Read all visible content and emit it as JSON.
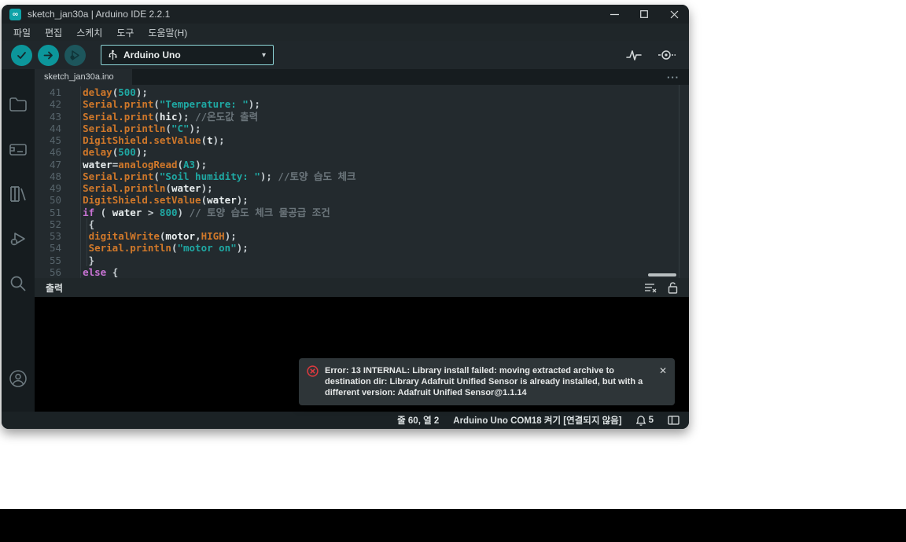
{
  "window": {
    "title": "sketch_jan30a | Arduino IDE 2.2.1"
  },
  "menu": {
    "items": [
      "파일",
      "편집",
      "스케치",
      "도구",
      "도움말(H)"
    ]
  },
  "toolbar": {
    "verify_icon": "check-icon",
    "upload_icon": "right-arrow-icon",
    "debug_icon": "debug-icon",
    "board_selector": {
      "label": "Arduino Uno",
      "usb_icon": "usb-icon",
      "caret": "▾"
    },
    "right_icons": [
      "serial-plotter-icon",
      "serial-monitor-icon"
    ]
  },
  "sidebar": {
    "items": [
      "sketchbook-folder",
      "boards-manager",
      "library-manager",
      "debug",
      "search"
    ],
    "bottom_item": "account"
  },
  "tabs": [
    {
      "label": "sketch_jan30a.ino",
      "active": true
    }
  ],
  "tab_bar": {
    "more": "···"
  },
  "editor": {
    "lines": [
      {
        "num": "41",
        "segs": [
          [
            "pl",
            "  "
          ],
          [
            "fn",
            "delay"
          ],
          [
            "pl",
            "("
          ],
          [
            "num",
            "500"
          ],
          [
            "pl",
            ");"
          ]
        ]
      },
      {
        "num": "42",
        "segs": [
          [
            "pl",
            "  "
          ],
          [
            "fn",
            "Serial.print"
          ],
          [
            "pl",
            "("
          ],
          [
            "str",
            "\"Temperature: \""
          ],
          [
            "pl",
            ");"
          ]
        ]
      },
      {
        "num": "43",
        "segs": [
          [
            "pl",
            "  "
          ],
          [
            "fn",
            "Serial.print"
          ],
          [
            "pl",
            "("
          ],
          [
            "id",
            "hic"
          ],
          [
            "pl",
            "); "
          ],
          [
            "cmt",
            "//온도값 출력"
          ]
        ]
      },
      {
        "num": "44",
        "segs": [
          [
            "pl",
            "  "
          ],
          [
            "fn",
            "Serial.println"
          ],
          [
            "pl",
            "("
          ],
          [
            "str",
            "\"C\""
          ],
          [
            "pl",
            ");"
          ]
        ]
      },
      {
        "num": "45",
        "segs": [
          [
            "pl",
            "  "
          ],
          [
            "fn",
            "DigitShield.setValue"
          ],
          [
            "pl",
            "("
          ],
          [
            "id",
            "t"
          ],
          [
            "pl",
            ");"
          ]
        ]
      },
      {
        "num": "46",
        "segs": [
          [
            "pl",
            "  "
          ],
          [
            "fn",
            "delay"
          ],
          [
            "pl",
            "("
          ],
          [
            "num",
            "500"
          ],
          [
            "pl",
            ");"
          ]
        ]
      },
      {
        "num": "47",
        "segs": [
          [
            "pl",
            "  "
          ],
          [
            "id",
            "water"
          ],
          [
            "pl",
            "="
          ],
          [
            "fn",
            "analogRead"
          ],
          [
            "pl",
            "("
          ],
          [
            "num",
            "A3"
          ],
          [
            "pl",
            ");"
          ]
        ]
      },
      {
        "num": "48",
        "segs": [
          [
            "pl",
            "  "
          ],
          [
            "fn",
            "Serial.print"
          ],
          [
            "pl",
            "("
          ],
          [
            "str",
            "\"Soil humidity: \""
          ],
          [
            "pl",
            "); "
          ],
          [
            "cmt",
            "//토양 습도 체크"
          ]
        ]
      },
      {
        "num": "49",
        "segs": [
          [
            "pl",
            "  "
          ],
          [
            "fn",
            "Serial.println"
          ],
          [
            "pl",
            "("
          ],
          [
            "id",
            "water"
          ],
          [
            "pl",
            ");"
          ]
        ]
      },
      {
        "num": "50",
        "segs": [
          [
            "pl",
            "  "
          ],
          [
            "fn",
            "DigitShield.setValue"
          ],
          [
            "pl",
            "("
          ],
          [
            "id",
            "water"
          ],
          [
            "pl",
            ");"
          ]
        ]
      },
      {
        "num": "51",
        "segs": [
          [
            "pl",
            "  "
          ],
          [
            "kw",
            "if"
          ],
          [
            "pl",
            " ( "
          ],
          [
            "id",
            "water"
          ],
          [
            "pl",
            " > "
          ],
          [
            "num",
            "800"
          ],
          [
            "pl",
            ") "
          ],
          [
            "cmt",
            "// 토양 습도 체크 물공급 조건"
          ]
        ]
      },
      {
        "num": "52",
        "g2": true,
        "segs": [
          [
            "pl",
            "   {"
          ]
        ]
      },
      {
        "num": "53",
        "g2": true,
        "segs": [
          [
            "pl",
            "   "
          ],
          [
            "fn",
            "digitalWrite"
          ],
          [
            "pl",
            "("
          ],
          [
            "id",
            "motor"
          ],
          [
            "pl",
            ","
          ],
          [
            "fn",
            "HIGH"
          ],
          [
            "pl",
            ");"
          ]
        ]
      },
      {
        "num": "54",
        "g2": true,
        "segs": [
          [
            "pl",
            "   "
          ],
          [
            "fn",
            "Serial.println"
          ],
          [
            "pl",
            "("
          ],
          [
            "str",
            "\"motor on\""
          ],
          [
            "pl",
            ");"
          ]
        ]
      },
      {
        "num": "55",
        "g2": true,
        "segs": [
          [
            "pl",
            "   }"
          ]
        ]
      },
      {
        "num": "56",
        "segs": [
          [
            "pl",
            "  "
          ],
          [
            "kw",
            "else"
          ],
          [
            "pl",
            " {"
          ]
        ]
      }
    ]
  },
  "output": {
    "title": "출력",
    "icons": [
      "clear-output",
      "lock-output"
    ]
  },
  "notification": {
    "severity": "error",
    "message": "Error: 13 INTERNAL: Library install failed: moving extracted archive to destination dir: Library Adafruit Unified Sensor is already installed, but with a different version: Adafruit Unified Sensor@1.1.14",
    "close": "✕"
  },
  "statusbar": {
    "cursor": "줄 60, 열 2",
    "board": "Arduino Uno COM18 켜기 [연결되지 않음]",
    "notification_count": "5"
  },
  "colors": {
    "accent_teal": "#0fa3a8",
    "toolbar_button": "#0c969b",
    "debug_button": "#1d565c",
    "error_red": "#e0393e",
    "editor_bg": "#232a2e",
    "chrome_bg": "#1f2629",
    "sidebar_bg": "#161c1f",
    "console_bg": "#000000",
    "syntax_function": "#d0782a",
    "syntax_string": "#1fa8a3",
    "syntax_keyword": "#c873d4",
    "syntax_comment": "#6b757b"
  }
}
